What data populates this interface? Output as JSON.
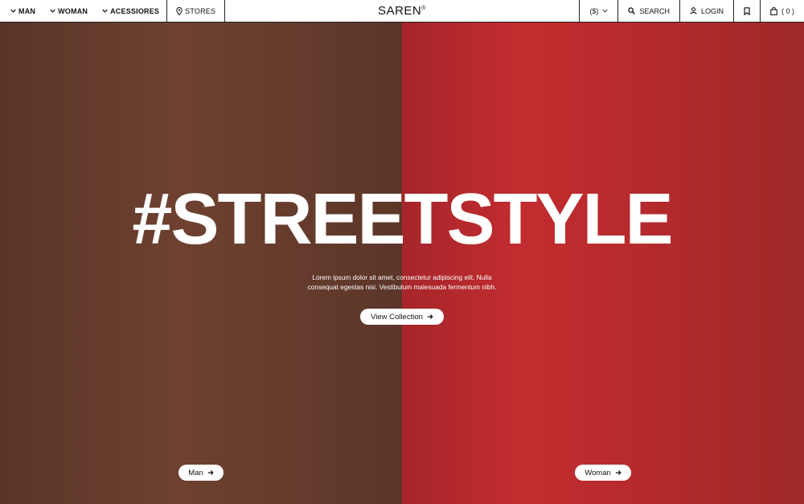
{
  "nav": {
    "left": [
      {
        "label": "MAN"
      },
      {
        "label": "WOMAN"
      },
      {
        "label": "ACESSIORES"
      }
    ],
    "stores": "STORES",
    "logo": "SAREN",
    "logo_mark": "®",
    "currency": "($)",
    "search": "SEARCH",
    "login": "LOGIN",
    "cart": "( 0 )"
  },
  "hero": {
    "headline": "#STREETSTYLE",
    "description_line1": "Lorem ipsum dolor sit amet, consectetur adipiscing elit. Nulla",
    "description_line2": "consequat egestas nisi. Vestibulum malesuada fermentum nibh.",
    "cta": "View Collection",
    "man_button": "Man",
    "woman_button": "Woman",
    "left_photo_color": "#6e4130",
    "right_photo_color": "#c32c2f"
  }
}
